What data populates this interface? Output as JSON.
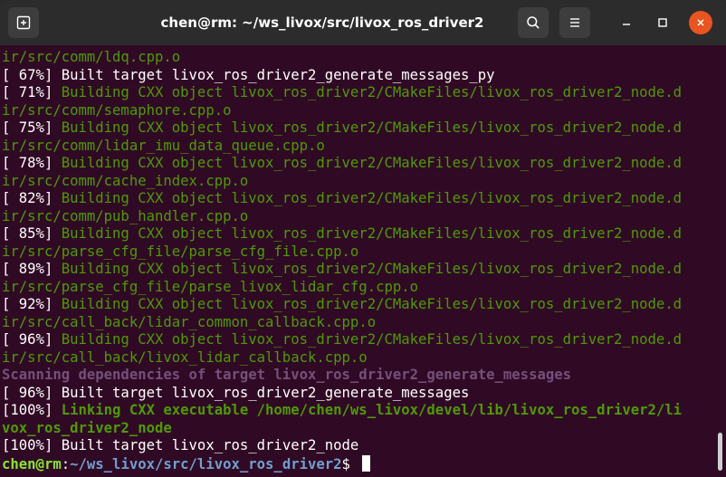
{
  "window": {
    "title": "chen@rm: ~/ws_livox/src/livox_ros_driver2",
    "icons": {
      "new_tab": "new-tab-icon",
      "search": "search-icon",
      "menu": "hamburger-menu-icon",
      "minimize": "minimize-icon",
      "maximize": "maximize-icon",
      "close": "close-icon"
    }
  },
  "colors": {
    "background": "#300a24",
    "titlebar": "#2c2c2c",
    "green": "#4e9a06",
    "bright_green": "#8ae234",
    "blue": "#729fcf",
    "magenta": "#75507b",
    "close": "#e95420"
  },
  "terminal": {
    "lines": [
      [
        {
          "t": "ir/src/comm/ldq.cpp.o",
          "c": "green"
        }
      ],
      [
        {
          "t": "[ 67%] ",
          "c": "white"
        },
        {
          "t": "Built target livox_ros_driver2_generate_messages_py",
          "c": "white"
        }
      ],
      [
        {
          "t": "[ 71%] ",
          "c": "white"
        },
        {
          "t": "Building CXX object livox_ros_driver2/CMakeFiles/livox_ros_driver2_node.d",
          "c": "green"
        }
      ],
      [
        {
          "t": "ir/src/comm/semaphore.cpp.o",
          "c": "green"
        }
      ],
      [
        {
          "t": "[ 75%] ",
          "c": "white"
        },
        {
          "t": "Building CXX object livox_ros_driver2/CMakeFiles/livox_ros_driver2_node.d",
          "c": "green"
        }
      ],
      [
        {
          "t": "ir/src/comm/lidar_imu_data_queue.cpp.o",
          "c": "green"
        }
      ],
      [
        {
          "t": "[ 78%] ",
          "c": "white"
        },
        {
          "t": "Building CXX object livox_ros_driver2/CMakeFiles/livox_ros_driver2_node.d",
          "c": "green"
        }
      ],
      [
        {
          "t": "ir/src/comm/cache_index.cpp.o",
          "c": "green"
        }
      ],
      [
        {
          "t": "[ 82%] ",
          "c": "white"
        },
        {
          "t": "Building CXX object livox_ros_driver2/CMakeFiles/livox_ros_driver2_node.d",
          "c": "green"
        }
      ],
      [
        {
          "t": "ir/src/comm/pub_handler.cpp.o",
          "c": "green"
        }
      ],
      [
        {
          "t": "[ 85%] ",
          "c": "white"
        },
        {
          "t": "Building CXX object livox_ros_driver2/CMakeFiles/livox_ros_driver2_node.d",
          "c": "green"
        }
      ],
      [
        {
          "t": "ir/src/parse_cfg_file/parse_cfg_file.cpp.o",
          "c": "green"
        }
      ],
      [
        {
          "t": "[ 89%] ",
          "c": "white"
        },
        {
          "t": "Building CXX object livox_ros_driver2/CMakeFiles/livox_ros_driver2_node.d",
          "c": "green"
        }
      ],
      [
        {
          "t": "ir/src/parse_cfg_file/parse_livox_lidar_cfg.cpp.o",
          "c": "green"
        }
      ],
      [
        {
          "t": "[ 92%] ",
          "c": "white"
        },
        {
          "t": "Building CXX object livox_ros_driver2/CMakeFiles/livox_ros_driver2_node.d",
          "c": "green"
        }
      ],
      [
        {
          "t": "ir/src/call_back/lidar_common_callback.cpp.o",
          "c": "green"
        }
      ],
      [
        {
          "t": "[ 96%] ",
          "c": "white"
        },
        {
          "t": "Building CXX object livox_ros_driver2/CMakeFiles/livox_ros_driver2_node.d",
          "c": "green"
        }
      ],
      [
        {
          "t": "ir/src/call_back/livox_lidar_callback.cpp.o",
          "c": "green"
        }
      ],
      [
        {
          "t": "Scanning dependencies of target livox_ros_driver2_generate_messages",
          "c": "magenta-bold"
        }
      ],
      [
        {
          "t": "[ 96%] ",
          "c": "white"
        },
        {
          "t": "Built target livox_ros_driver2_generate_messages",
          "c": "white"
        }
      ],
      [
        {
          "t": "[100%] ",
          "c": "white"
        },
        {
          "t": "Linking CXX executable /home/chen/ws_livox/devel/lib/livox_ros_driver2/li",
          "c": "green-bold"
        }
      ],
      [
        {
          "t": "vox_ros_driver2_node",
          "c": "green-bold"
        }
      ],
      [
        {
          "t": "[100%] ",
          "c": "white"
        },
        {
          "t": "Built target livox_ros_driver2_node",
          "c": "white"
        }
      ]
    ],
    "prompt": {
      "user_host": "chen@rm",
      "separator": ":",
      "path": "~/ws_livox/src/livox_ros_driver2",
      "symbol": "$ "
    }
  }
}
